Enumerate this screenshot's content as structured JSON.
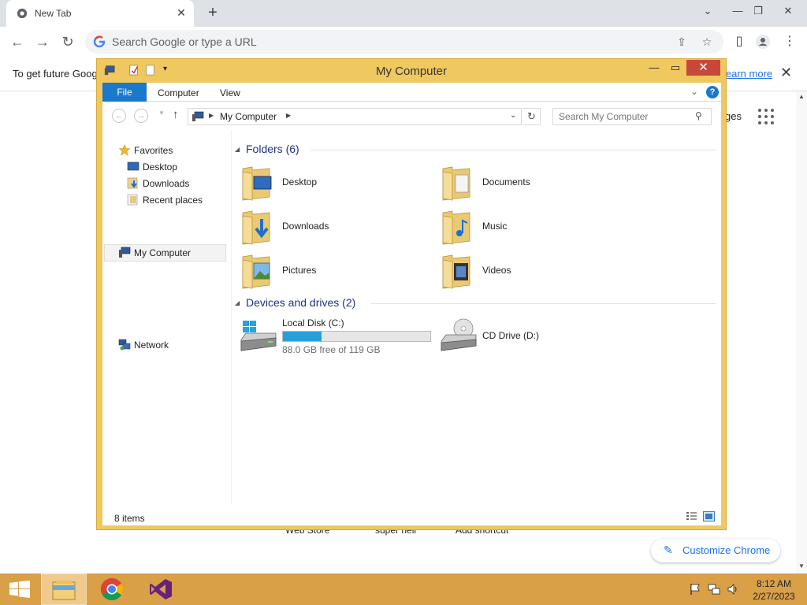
{
  "chrome": {
    "tab_title": "New Tab",
    "tab_close": "✕",
    "new_tab": "+",
    "omnibox_placeholder": "Search Google or type a URL",
    "signin_message": "To get future Goog",
    "learn_more": "learn more",
    "images_link": "ges",
    "shortcuts": [
      "Web Store",
      "super hell",
      "Add shortcut"
    ],
    "customize_label": "Customize Chrome"
  },
  "explorer": {
    "title": "My Computer",
    "ribbon": {
      "file": "File",
      "tabs": [
        "Computer",
        "View"
      ]
    },
    "address": {
      "crumb": "My Computer",
      "search_placeholder": "Search My Computer"
    },
    "nav": {
      "favorites": "Favorites",
      "favorites_items": [
        "Desktop",
        "Downloads",
        "Recent places"
      ],
      "computer": "My Computer",
      "network": "Network"
    },
    "folders_header": "Folders (6)",
    "folders": [
      "Desktop",
      "Documents",
      "Downloads",
      "Music",
      "Pictures",
      "Videos"
    ],
    "devices_header": "Devices and drives (2)",
    "drives": [
      {
        "name": "Local Disk (C:)",
        "free": "88.0 GB free of 119 GB",
        "used_fraction": 0.26
      },
      {
        "name": "CD Drive (D:)"
      }
    ],
    "status_items": "8 items"
  },
  "taskbar": {
    "time": "8:12 AM",
    "date": "2/27/2023"
  },
  "colors": {
    "window_frame": "#f0c860",
    "taskbar": "#d9a048",
    "ribbon_file": "#1979ca",
    "drive_bar": "#26a0da",
    "group_header": "#1e3287",
    "close_button": "#c7483b",
    "chrome_link": "#1a73e8"
  },
  "icons": [
    "chrome-favicon",
    "google-g-icon",
    "share-icon",
    "star-icon",
    "sidepanel-icon",
    "profile-icon",
    "kebab-menu-icon",
    "apps-grid-icon",
    "folder-icon",
    "drive-icon",
    "cd-drive-icon",
    "windows-logo-icon",
    "visual-studio-icon"
  ]
}
